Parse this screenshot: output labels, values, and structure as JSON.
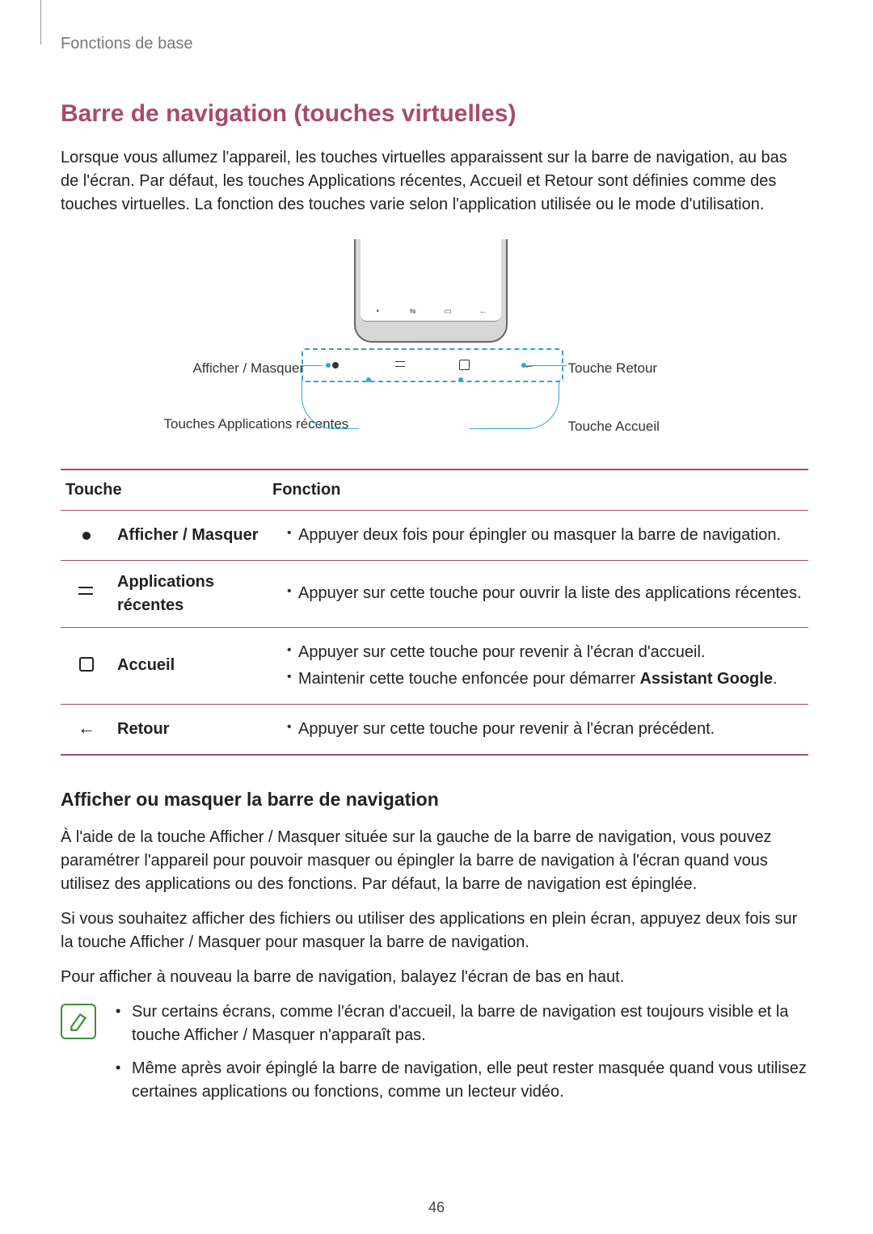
{
  "breadcrumb": "Fonctions de base",
  "title": "Barre de navigation (touches virtuelles)",
  "intro": "Lorsque vous allumez l'appareil, les touches virtuelles apparaissent sur la barre de navigation, au bas de l'écran. Par défaut, les touches Applications récentes, Accueil et Retour sont définies comme des touches virtuelles. La fonction des touches varie selon l'application utilisée ou le mode d'utilisation.",
  "figure": {
    "label_show_hide": "Afficher / Masquer",
    "label_recents": "Touches Applications récentes",
    "label_back": "Touche Retour",
    "label_home": "Touche Accueil"
  },
  "table": {
    "head_touche": "Touche",
    "head_fonction": "Fonction",
    "rows": [
      {
        "icon": "dot",
        "label": "Afficher / Masquer",
        "functions": [
          "Appuyer deux fois pour épingler ou masquer la barre de navigation."
        ]
      },
      {
        "icon": "recents",
        "label": "Applications récentes",
        "functions": [
          "Appuyer sur cette touche pour ouvrir la liste des applications récentes."
        ]
      },
      {
        "icon": "square",
        "label": "Accueil",
        "functions": [
          "Appuyer sur cette touche pour revenir à l'écran d'accueil.",
          "Maintenir cette touche enfoncée pour démarrer Assistant Google."
        ]
      },
      {
        "icon": "back",
        "label": "Retour",
        "functions": [
          "Appuyer sur cette touche pour revenir à l'écran précédent."
        ]
      }
    ]
  },
  "sub_heading": "Afficher ou masquer la barre de navigation",
  "para1": "À l'aide de la touche Afficher / Masquer située sur la gauche de la barre de navigation, vous pouvez paramétrer l'appareil pour pouvoir masquer ou épingler la barre de navigation à l'écran quand vous utilisez des applications ou des fonctions. Par défaut, la barre de navigation est épinglée.",
  "para2": "Si vous souhaitez afficher des fichiers ou utiliser des applications en plein écran, appuyez deux fois sur la touche Afficher / Masquer pour masquer la barre de navigation.",
  "para3": "Pour afficher à nouveau la barre de navigation, balayez l'écran de bas en haut.",
  "notes": [
    "Sur certains écrans, comme l'écran d'accueil, la barre de navigation est toujours visible et la touche Afficher / Masquer n'apparaît pas.",
    "Même après avoir épinglé la barre de navigation, elle peut rester masquée quand vous utilisez certaines applications ou fonctions, comme un lecteur vidéo."
  ],
  "page_number": "46"
}
